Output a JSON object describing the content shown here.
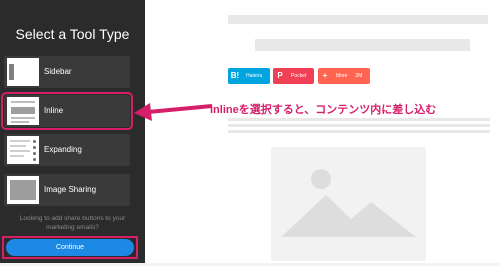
{
  "panel": {
    "title": "Select a Tool Type",
    "tools": [
      {
        "label": "Sidebar"
      },
      {
        "label": "Inline"
      },
      {
        "label": "Expanding"
      },
      {
        "label": "Image Sharing"
      }
    ],
    "note": "Looking to add share buttons to your marketing emails?",
    "continue_label": "Continue"
  },
  "share_buttons": [
    {
      "icon": "B!",
      "label": "Hatena",
      "count": "",
      "color": "#00a4de"
    },
    {
      "icon": "P",
      "label": "Pocket",
      "count": "",
      "color": "#ef4056"
    },
    {
      "icon": "+",
      "label": "More",
      "count": "2M",
      "color": "#ff6550"
    }
  ],
  "annotation": "inlineを選択すると、コンテンツ内に差し込む",
  "colors": {
    "panel_bg": "#2b2b2b",
    "highlight": "#d61f69",
    "continue": "#1e88e5"
  }
}
